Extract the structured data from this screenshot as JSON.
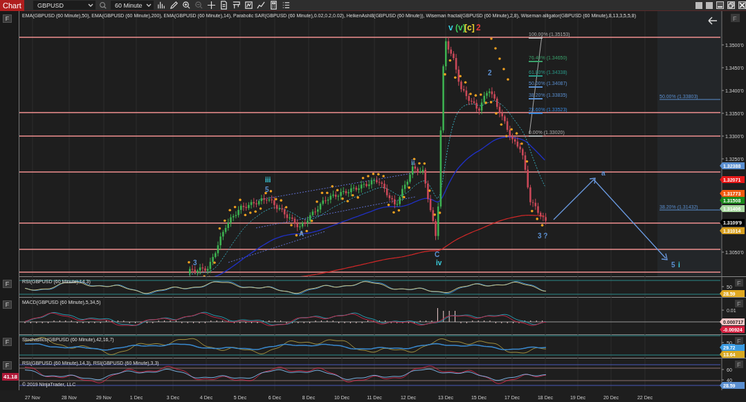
{
  "toolbar": {
    "title": "Chart",
    "instrument": "GBPUSD",
    "interval": "60 Minute"
  },
  "main_panel": {
    "left_button": "F",
    "right_button": "F",
    "indicators": "EMA(GBPUSD (60 Minute),50), EMA(GBPUSD (60 Minute),200), EMA(GBPUSD (60 Minute),14), Parabolic SAR(GBPUSD (60 Minute),0.02,0.2,0.02), HeikenAshi8(GBPUSD (60 Minute)), Wiseman fractal(GBPUSD (60 Minute),2,8), Wiseman alligator(GBPUSD (60 Minute),8,13,3,5,5,8)",
    "wave_labels": [
      {
        "text": "v",
        "color": "#3ad0e0"
      },
      {
        "text": "(v)",
        "color": "#3ec85a"
      },
      {
        "text": "[c]",
        "color": "#e8d030"
      },
      {
        "text": "2",
        "color": "#e03a3a"
      },
      {
        "text": "iii",
        "color": "#3ad0e0"
      },
      {
        "text": "5",
        "color": "#5b8fd0"
      },
      {
        "text": "ii",
        "color": "#5b8fd0"
      },
      {
        "text": "3",
        "color": "#5b8fd0"
      },
      {
        "text": "A",
        "color": "#5b8fd0"
      },
      {
        "text": "C",
        "color": "#5b8fd0"
      },
      {
        "text": "iv",
        "color": "#3ad0e0"
      },
      {
        "text": "2",
        "color": "#5b8fd0"
      },
      {
        "text": "3 ?",
        "color": "#5b8fd0"
      },
      {
        "text": "a",
        "color": "#5b8fd0"
      },
      {
        "text": "5",
        "color": "#5b8fd0"
      },
      {
        "text": "i",
        "color": "#3ad0e0"
      }
    ],
    "fib_levels": [
      {
        "label": "100.00% (1.35153)",
        "color": "#b0b0b0"
      },
      {
        "label": "76.40% (1.34650)",
        "color": "#3aa06a"
      },
      {
        "label": "61.80% (1.34338)",
        "color": "#2a9a8a"
      },
      {
        "label": "50.00% (1.34087)",
        "color": "#5a8fd0"
      },
      {
        "label": "38.20% (1.33835)",
        "color": "#5a8fd0"
      },
      {
        "label": "23.60% (1.33523)",
        "color": "#3a8ae0"
      },
      {
        "label": "0.00% (1.33020)",
        "color": "#b0b0b0"
      }
    ],
    "projection_levels": [
      {
        "label": "50.00% (1.33803)"
      },
      {
        "label": "38.20% (1.31432)"
      }
    ],
    "axis_labels": [
      "1.3500'0",
      "1.3450'0",
      "1.3400'0",
      "1.3350'0",
      "1.3300'0",
      "1.3250'0",
      "1.3050'0"
    ],
    "price_tags": [
      {
        "text": "1.32388",
        "color": "#5b8fd0"
      },
      {
        "text": "1.32071",
        "color": "#e81818"
      },
      {
        "text": "1.31773",
        "color": "#f05a10"
      },
      {
        "text": "1.31508",
        "color": "#1a8a1a"
      },
      {
        "text": "1.31406",
        "color": "#a8d8a0"
      },
      {
        "text": "1.3109'9",
        "color": "#000000"
      },
      {
        "text": "1.31014",
        "color": "#d8a020"
      }
    ]
  },
  "panels": [
    {
      "kind": "rsi",
      "left_button": "F",
      "right_button": "F",
      "title": "RSI(GBPUSD (60 Minute),14,3)",
      "axis_labels": [
        "50"
      ],
      "tags": [
        {
          "text": "28.59",
          "color": "#e0a820"
        }
      ]
    },
    {
      "kind": "macd",
      "left_button": "F",
      "right_button": "F",
      "title": "MACD(GBPUSD (60 Minute),5,34,5)",
      "axis_labels": [
        "0.01"
      ],
      "tags": [
        {
          "text": "0.000717",
          "color": "#f8c8c8"
        },
        {
          "text": "-0.00924",
          "color": "#d82040"
        }
      ]
    },
    {
      "kind": "stochastics",
      "left_button": "F",
      "right_button": "F",
      "title": "Stochastics(GBPUSD (60 Minute),42,16,7)",
      "axis_labels": [
        "50"
      ],
      "tags": [
        {
          "text": "29.72",
          "color": "#3a9ae0"
        },
        {
          "text": "13.64",
          "color": "#d8a820"
        }
      ]
    },
    {
      "kind": "dual_rsi",
      "left_button": "F",
      "right_button": "F",
      "title": "RSI(GBPUSD (60 Minute),14,3), RSI(GBPUSD (60 Minute),3,3)",
      "axis_labels": [
        "60",
        "40"
      ],
      "tags": [
        {
          "text": "28.59",
          "color": "#5b8fd0"
        }
      ],
      "left_tag": {
        "text": "41.18",
        "color": "#b01838"
      },
      "copyright": "© 2019 NinjaTrader, LLC"
    }
  ],
  "date_axis": [
    "27 Nov",
    "28 Nov",
    "29 Nov",
    "1 Dec",
    "3 Dec",
    "4 Dec",
    "5 Dec",
    "6 Dec",
    "8 Dec",
    "10 Dec",
    "11 Dec",
    "12 Dec",
    "13 Dec",
    "15 Dec",
    "17 Dec",
    "18 Dec",
    "19 Dec",
    "20 Dec",
    "22 Dec"
  ]
}
